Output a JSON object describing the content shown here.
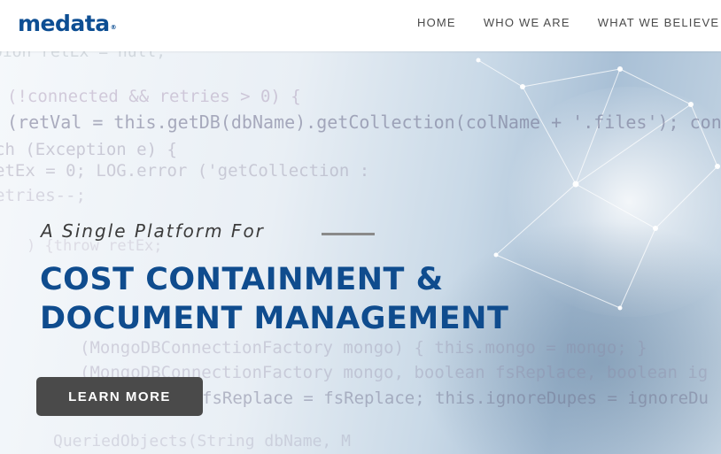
{
  "brand": {
    "logo_text": "medata",
    "registered_mark": "®"
  },
  "nav": {
    "items": [
      {
        "label": "HOME"
      },
      {
        "label": "WHO WE ARE"
      },
      {
        "label": "WHAT WE BELIEVE"
      }
    ]
  },
  "hero": {
    "background_code": [
      {
        "text": "oion retEx = null;"
      },
      {
        "text": "(!connected && retries > 0) {"
      },
      {
        "text": "(retVal = this.getDB(dbName).getCollection(colName + '.files'); connec"
      },
      {
        "text": "ch (Exception e) {"
      },
      {
        "text": "etEx = 0; LOG.error ('getCollection :"
      },
      {
        "text": "etries--;"
      },
      {
        "text": ") {throw retEx;"
      },
      {
        "text": "(MongoDBConnectionFactory mongo) { this.mongo = mongo; }"
      },
      {
        "text": "(MongoDBConnectionFactory mongo, boolean fsReplace, boolean ig"
      },
      {
        "text": "fsReplace = fsReplace; this.ignoreDupes = ignoreDu"
      },
      {
        "text": "QueriedObjects(String dbName, M"
      }
    ],
    "tagline": "A Single Platform For",
    "headline_line1": "COST CONTAINMENT &",
    "headline_line2": "DOCUMENT MANAGEMENT",
    "cta_label": "LEARN MORE"
  },
  "colors": {
    "brand_blue": "#0f4c8e",
    "nav_text": "#4a4a4a",
    "button_bg": "#4a4a4a",
    "button_text": "#ffffff",
    "tagline_text": "#3c3c3c"
  }
}
